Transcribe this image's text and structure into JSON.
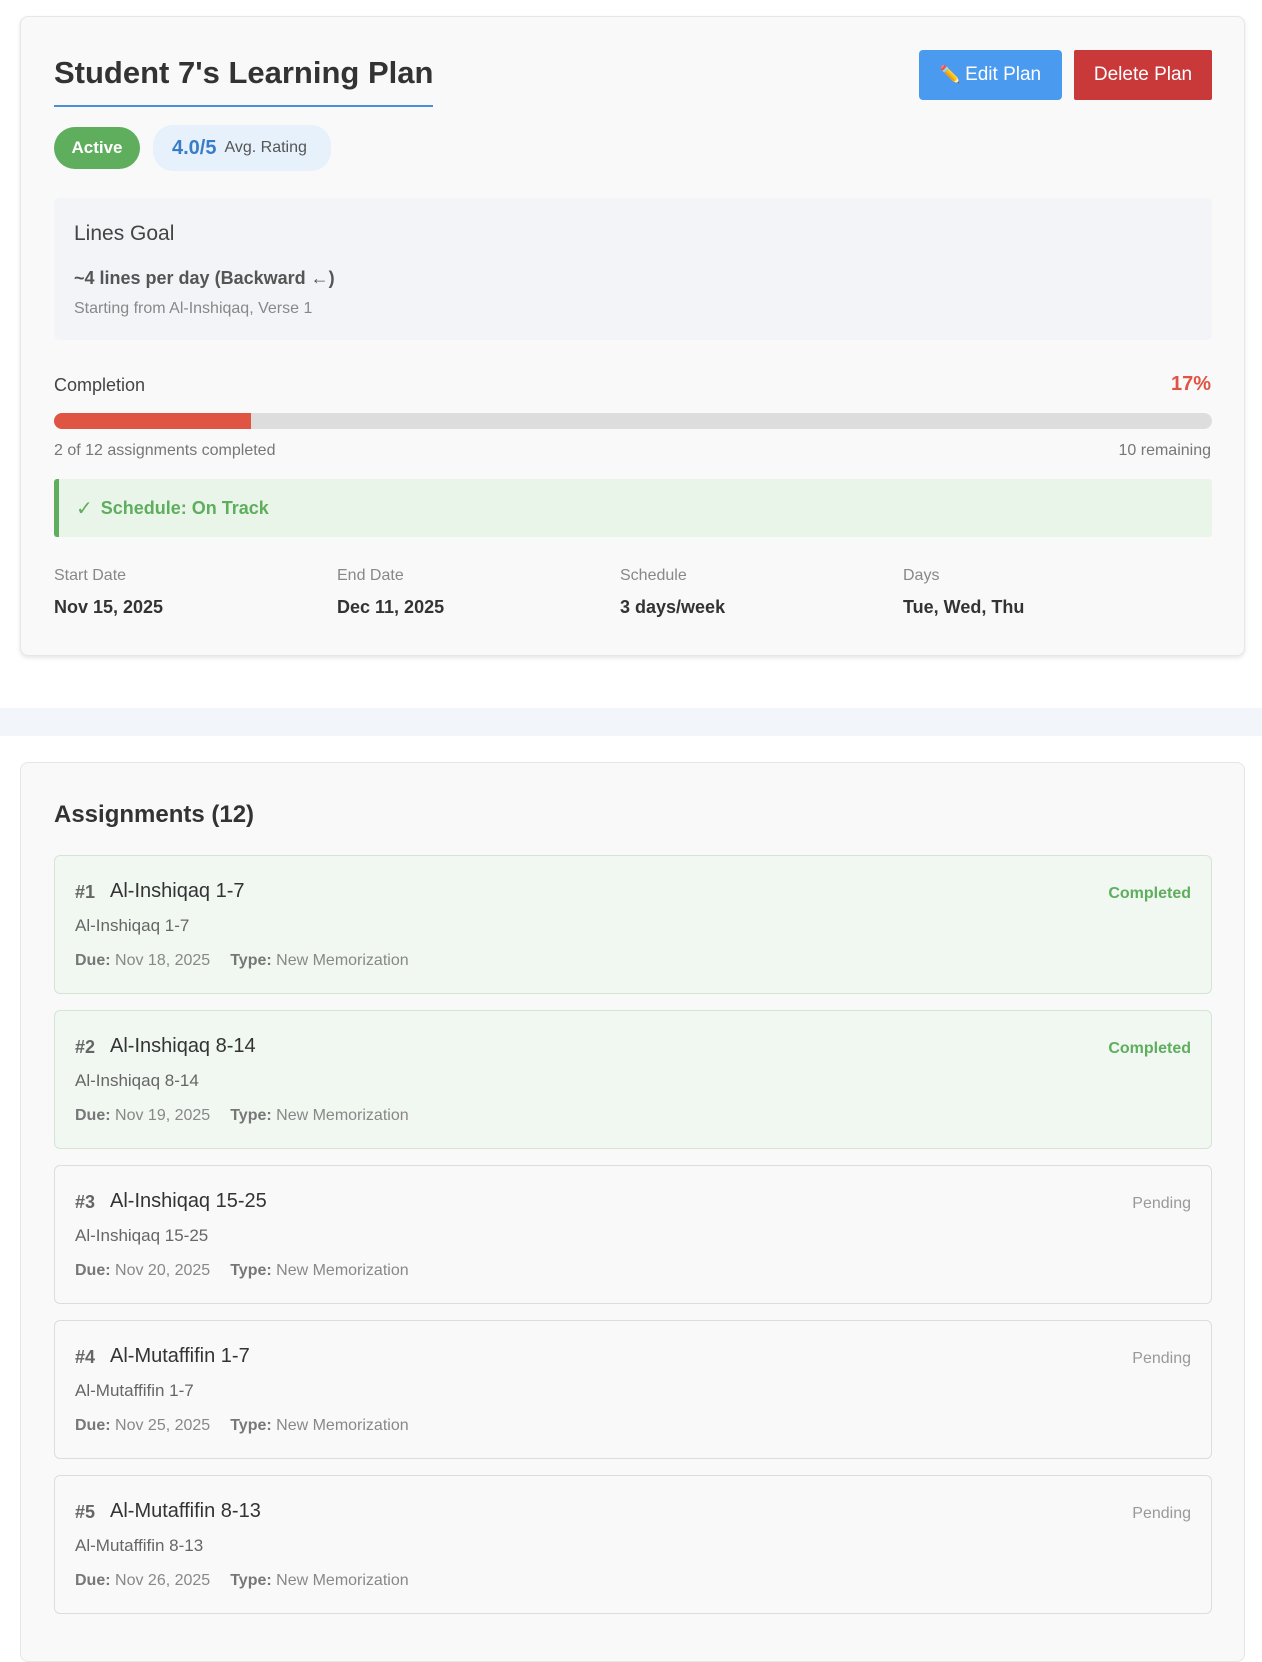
{
  "plan": {
    "title": "Student 7's Learning Plan",
    "edit_label": "Edit Plan",
    "delete_label": "Delete Plan",
    "status": "Active",
    "rating_value": "4.0/5",
    "rating_label": "Avg. Rating",
    "goal": {
      "title": "Lines Goal",
      "main": "~4 lines per day (Backward ←)",
      "sub": "Starting from Al-Inshiqaq, Verse 1"
    },
    "completion": {
      "label": "Completion",
      "percent_text": "17%",
      "fraction": 0.17,
      "count_text": "2 of 12 assignments completed",
      "remaining_text": "10 remaining"
    },
    "schedule_status": "Schedule: On Track",
    "meta": [
      {
        "label": "Start Date",
        "value": "Nov 15, 2025"
      },
      {
        "label": "End Date",
        "value": "Dec 11, 2025"
      },
      {
        "label": "Schedule",
        "value": "3 days/week"
      },
      {
        "label": "Days",
        "value": "Tue, Wed, Thu"
      }
    ],
    "colors": {
      "accent": "#4a9af0",
      "danger": "#c9393a",
      "success": "#5eae5e",
      "progress": "#e05444"
    }
  },
  "assignments": {
    "title": "Assignments (12)",
    "due_label": "Due:",
    "type_label": "Type:",
    "items": [
      {
        "num": "#1",
        "name": "Al-Inshiqaq 1-7",
        "sub": "Al-Inshiqaq 1-7",
        "due": "Nov 18, 2025",
        "type": "New Memorization",
        "status": "Completed"
      },
      {
        "num": "#2",
        "name": "Al-Inshiqaq 8-14",
        "sub": "Al-Inshiqaq 8-14",
        "due": "Nov 19, 2025",
        "type": "New Memorization",
        "status": "Completed"
      },
      {
        "num": "#3",
        "name": "Al-Inshiqaq 15-25",
        "sub": "Al-Inshiqaq 15-25",
        "due": "Nov 20, 2025",
        "type": "New Memorization",
        "status": "Pending"
      },
      {
        "num": "#4",
        "name": "Al-Mutaffifin 1-7",
        "sub": "Al-Mutaffifin 1-7",
        "due": "Nov 25, 2025",
        "type": "New Memorization",
        "status": "Pending"
      },
      {
        "num": "#5",
        "name": "Al-Mutaffifin 8-13",
        "sub": "Al-Mutaffifin 8-13",
        "due": "Nov 26, 2025",
        "type": "New Memorization",
        "status": "Pending"
      }
    ]
  }
}
